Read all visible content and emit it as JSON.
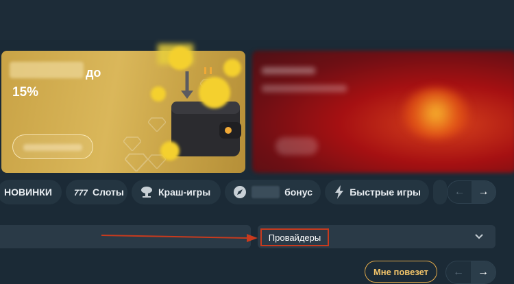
{
  "banner_gold": {
    "up_to": "до",
    "percent": "15%"
  },
  "categories": [
    {
      "label": "НОВИНКИ",
      "icon": "none"
    },
    {
      "label": "Слоты",
      "icon": "777-icon"
    },
    {
      "label": "Краш-игры",
      "icon": "mushroom-cloud-icon"
    },
    {
      "label": "бонус",
      "icon": "rocket-icon"
    },
    {
      "label": "Быстрые игры",
      "icon": "lightning-icon"
    }
  ],
  "category_nav": {
    "prev": "←",
    "next": "→"
  },
  "providers": {
    "label": "Провайдеры"
  },
  "lucky": {
    "label": "Мне повезет"
  },
  "pager": {
    "prev": "←",
    "next": "→"
  },
  "colors": {
    "accent_orange": "#e1a94a",
    "highlight_red": "#c93a1d",
    "gold_banner": "#d4b052"
  }
}
